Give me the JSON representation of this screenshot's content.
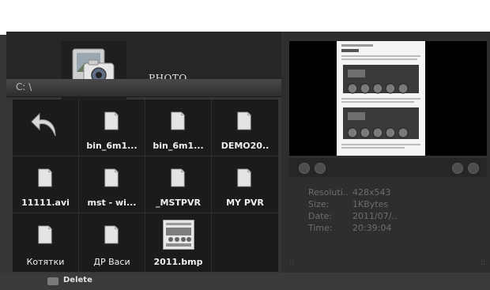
{
  "top_banner": {
    "text": ""
  },
  "header": {
    "title": "PHOTO"
  },
  "path": {
    "text": "C: \\"
  },
  "grid": {
    "items": [
      {
        "label": "",
        "type": "back"
      },
      {
        "label": "bin_6m1...",
        "type": "folder"
      },
      {
        "label": "bin_6m1...",
        "type": "folder"
      },
      {
        "label": "DEMO20..",
        "type": "folder"
      },
      {
        "label": "11111.avi",
        "type": "folder"
      },
      {
        "label": "mst - wi...",
        "type": "folder"
      },
      {
        "label": "_MSTPVR",
        "type": "folder"
      },
      {
        "label": "MY PVR",
        "type": "folder"
      },
      {
        "label": "Котятки",
        "type": "folder"
      },
      {
        "label": "ДР Васи",
        "type": "folder"
      },
      {
        "label": "2011.bmp",
        "type": "image"
      }
    ]
  },
  "info": {
    "resolution_key": "Resoluti..",
    "resolution_val": "428x543",
    "size_key": "Size:",
    "size_val": "1KBytes",
    "date_key": "Date:",
    "date_val": "2011/07/..",
    "time_key": "Time:",
    "time_val": "20:39:04"
  },
  "bottom": {
    "delete_label": "Delete"
  }
}
